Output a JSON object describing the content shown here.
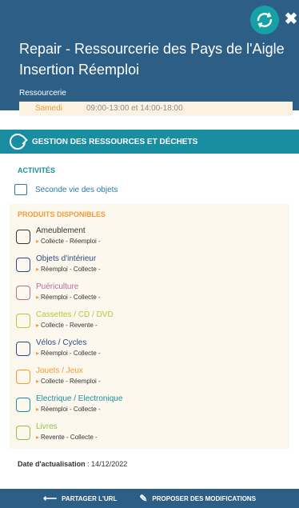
{
  "header": {
    "title": "Repair - Ressourcerie des Pays de l'Aigle Insertion Réemploi",
    "subtitle": "Ressourcerie",
    "close_glyph": "✖",
    "badge_icon": "recycle-icon",
    "color": "#2c5e86"
  },
  "hours": {
    "day": "Samedi",
    "times": "09:00-13:00  et  14:00-18:00"
  },
  "band": {
    "label": "GESTION DES RESSOURCES ET DÉCHETS",
    "color": "#188ea0"
  },
  "activities": {
    "title": "ACTIVITÉS",
    "items": [
      {
        "label": "Seconde vie des objets",
        "icon": "repair-objects-icon"
      }
    ]
  },
  "products": {
    "title": "PRODUITS DISPONIBLES",
    "items": [
      {
        "name": "Ameublement",
        "tags": "Collecte - Réemploi -",
        "color": "#333333",
        "icon": "armchair-icon"
      },
      {
        "name": "Objets d'intérieur",
        "tags": "Réemploi - Collecte -",
        "color": "#2c4a8a",
        "icon": "lamp-icon"
      },
      {
        "name": "Puériculture",
        "tags": "Réemploi - Collecte -",
        "color": "#b56aa5",
        "icon": "pacifier-icon"
      },
      {
        "name": "Cassettes / CD / DVD",
        "tags": "Collecte - Revente -",
        "color": "#b5c73c",
        "icon": "disc-icon"
      },
      {
        "name": "Vélos / Cycles",
        "tags": "Réemploi - Collecte -",
        "color": "#2c4a8a",
        "icon": "bicycle-icon"
      },
      {
        "name": "Jouets / Jeux",
        "tags": "Collecte - Réemploi -",
        "color": "#f29a37",
        "icon": "rocking-horse-icon"
      },
      {
        "name": "Electrique / Electronique",
        "tags": "Réemploi - Collecte -",
        "color": "#188ea0",
        "icon": "washing-machine-icon"
      },
      {
        "name": "Livres",
        "tags": "Revente - Collecte -",
        "color": "#8bc34a",
        "icon": "book-icon"
      }
    ]
  },
  "date": {
    "label": "Date d'actualisation",
    "value": " : 14/12/2022"
  },
  "footer": {
    "share": "PARTAGER L'URL",
    "propose": "PROPOSER DES MODIFICATIONS"
  }
}
